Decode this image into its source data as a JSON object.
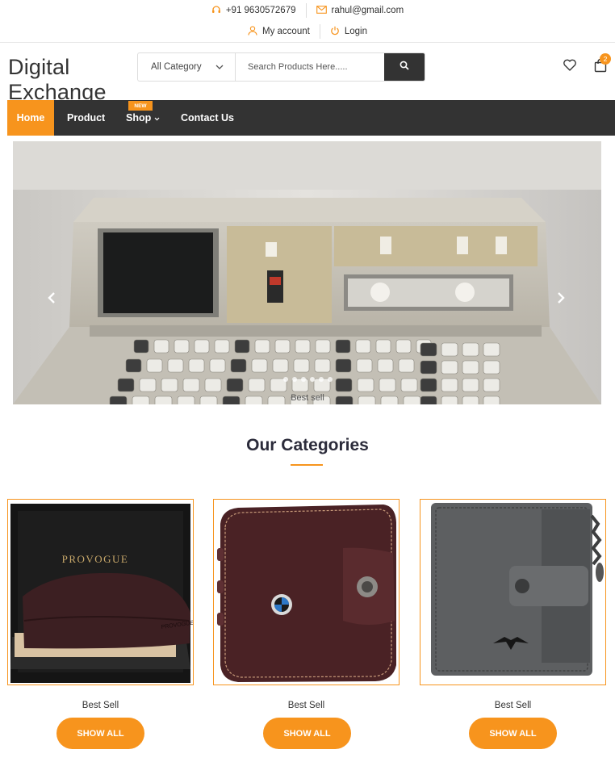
{
  "topbar": {
    "phone": "+91 9630572679",
    "email": "rahul@gmail.com",
    "account_label": "My account",
    "login_label": "Login"
  },
  "header": {
    "logo_line1": "Digital",
    "logo_line2": "Exchange",
    "category_select": "All Category",
    "search_placeholder": "Search Products Here.....",
    "cart_count": "2"
  },
  "nav": {
    "items": [
      {
        "label": "Home",
        "active": true
      },
      {
        "label": "Product"
      },
      {
        "label": "Shop",
        "tag": "NEW"
      },
      {
        "label": "Contact Us"
      }
    ]
  },
  "slider": {
    "caption": "Best sell",
    "prev_icon": "chevron-left-icon",
    "next_icon": "chevron-right-icon",
    "dots": 6
  },
  "categories": {
    "title": "Our Categories",
    "items": [
      {
        "label": "Best Sell",
        "button": "SHOW ALL",
        "brand_text": "PROVOGUE"
      },
      {
        "label": "Best Sell",
        "button": "SHOW ALL"
      },
      {
        "label": "Best Sell",
        "button": "SHOW ALL"
      }
    ]
  },
  "colors": {
    "accent": "#f7941d",
    "nav_bg": "#333333",
    "title": "#2b2b3a"
  }
}
